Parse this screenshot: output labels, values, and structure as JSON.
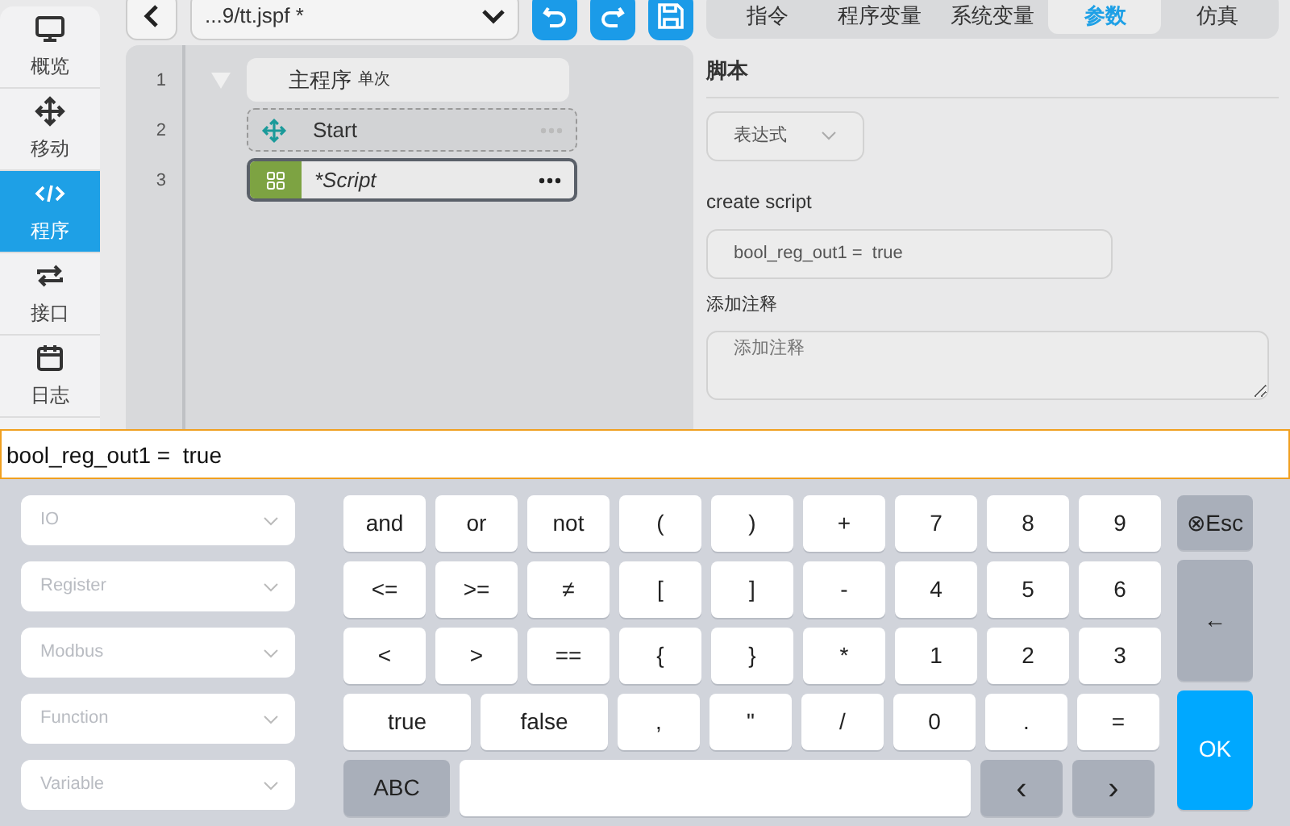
{
  "sidebar": {
    "items": [
      {
        "label": "概览",
        "kind": "monitor",
        "selected": false
      },
      {
        "label": "移动",
        "kind": "move",
        "selected": false
      },
      {
        "label": "程序",
        "kind": "code",
        "selected": true
      },
      {
        "label": "接口",
        "kind": "repeat",
        "selected": false
      },
      {
        "label": "日志",
        "kind": "calendar",
        "selected": false
      }
    ]
  },
  "toolbar": {
    "file": "...9/tt.jspf *"
  },
  "program": {
    "lines": [
      {
        "number": "1",
        "kind": "main",
        "label": "主程序",
        "tag": "单次",
        "expanded": true
      },
      {
        "number": "2",
        "kind": "move",
        "label": "Start",
        "selected": false
      },
      {
        "number": "3",
        "kind": "script",
        "label": "*Script",
        "selected": true
      }
    ]
  },
  "tabs": [
    {
      "label": "指令",
      "selected": false
    },
    {
      "label": "程序变量",
      "selected": false
    },
    {
      "label": "系统变量",
      "selected": false
    },
    {
      "label": "参数",
      "selected": true
    },
    {
      "label": "仿真",
      "selected": false
    }
  ],
  "panel": {
    "title": "脚本",
    "mode": "表达式",
    "script_label": "create script",
    "script_value": "bool_reg_out1 =  true",
    "comment_label": "添加注释",
    "comment_placeholder": "添加注释"
  },
  "editor": {
    "value": "bool_reg_out1 =  true"
  },
  "selectors": [
    {
      "placeholder": "IO"
    },
    {
      "placeholder": "Register"
    },
    {
      "placeholder": "Modbus"
    },
    {
      "placeholder": "Function"
    },
    {
      "placeholder": "Variable"
    }
  ],
  "keypad": {
    "rows": [
      [
        {
          "label": "and",
          "kind": "key"
        },
        {
          "label": "or",
          "kind": "key"
        },
        {
          "label": "not",
          "kind": "key"
        },
        {
          "label": "(",
          "kind": "key"
        },
        {
          "label": ")",
          "kind": "key"
        },
        {
          "label": "+",
          "kind": "key"
        },
        {
          "label": "7",
          "kind": "key"
        },
        {
          "label": "8",
          "kind": "key"
        },
        {
          "label": "9",
          "kind": "key"
        }
      ],
      [
        {
          "label": "<=",
          "kind": "key"
        },
        {
          "label": ">=",
          "kind": "key"
        },
        {
          "label": "≠",
          "kind": "key"
        },
        {
          "label": "[",
          "kind": "key"
        },
        {
          "label": "]",
          "kind": "key"
        },
        {
          "label": "-",
          "kind": "key"
        },
        {
          "label": "4",
          "kind": "key"
        },
        {
          "label": "5",
          "kind": "key"
        },
        {
          "label": "6",
          "kind": "key"
        }
      ],
      [
        {
          "label": "<",
          "kind": "key"
        },
        {
          "label": ">",
          "kind": "key"
        },
        {
          "label": "==",
          "kind": "key"
        },
        {
          "label": "{",
          "kind": "key"
        },
        {
          "label": "}",
          "kind": "key"
        },
        {
          "label": "*",
          "kind": "key"
        },
        {
          "label": "1",
          "kind": "key"
        },
        {
          "label": "2",
          "kind": "key"
        },
        {
          "label": "3",
          "kind": "key"
        }
      ]
    ],
    "literal_keys": [
      {
        "label": "true",
        "kind": "wide"
      },
      {
        "label": "false",
        "kind": "wide"
      }
    ],
    "symbol_keys": [
      {
        "label": ",",
        "kind": "key"
      },
      {
        "label": "\"",
        "kind": "key"
      },
      {
        "label": "/",
        "kind": "key"
      },
      {
        "label": "0",
        "kind": "key"
      },
      {
        "label": ".",
        "kind": "key"
      },
      {
        "label": "=",
        "kind": "key"
      }
    ],
    "bottom_keys": [
      {
        "label": "ABC",
        "kind": "mode"
      },
      {
        "kind": "space"
      },
      {
        "label": "‹",
        "kind": "nav"
      },
      {
        "label": "›",
        "kind": "nav"
      }
    ],
    "side": [
      {
        "label": "⊗Esc",
        "kind": "esc"
      },
      {
        "label": "←",
        "kind": "backspace"
      },
      {
        "label": "OK",
        "kind": "ok"
      }
    ]
  }
}
